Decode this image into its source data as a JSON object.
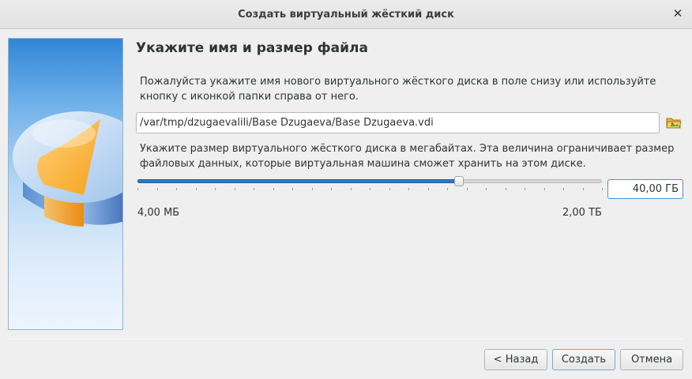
{
  "window": {
    "title": "Создать виртуальный жёсткий диск",
    "close_glyph": "✕"
  },
  "page": {
    "heading": "Укажите имя и размер файла",
    "location_description": "Пожалуйста укажите имя нового виртуального жёсткого диска в поле снизу или используйте кнопку с иконкой папки справа от него.",
    "location_value": "/var/tmp/dzugaevalili/Base Dzugaeva/Base Dzugaeva.vdi",
    "folder_icon": "folder-open-icon",
    "size_description": "Укажите размер виртуального жёсткого диска в мегабайтах. Эта величина ограничивает размер файловых данных, которые виртуальная машина сможет хранить на этом диске.",
    "size_slider_fraction": 0.692,
    "size_value": "40,00 ГБ",
    "size_min_label": "4,00 МБ",
    "size_max_label": "2,00 ТБ"
  },
  "buttons": {
    "back": "< Назад",
    "create": "Создать",
    "cancel": "Отмена"
  },
  "colors": {
    "accent": "#2f78c4",
    "watermark_top": "#2f86d6"
  }
}
